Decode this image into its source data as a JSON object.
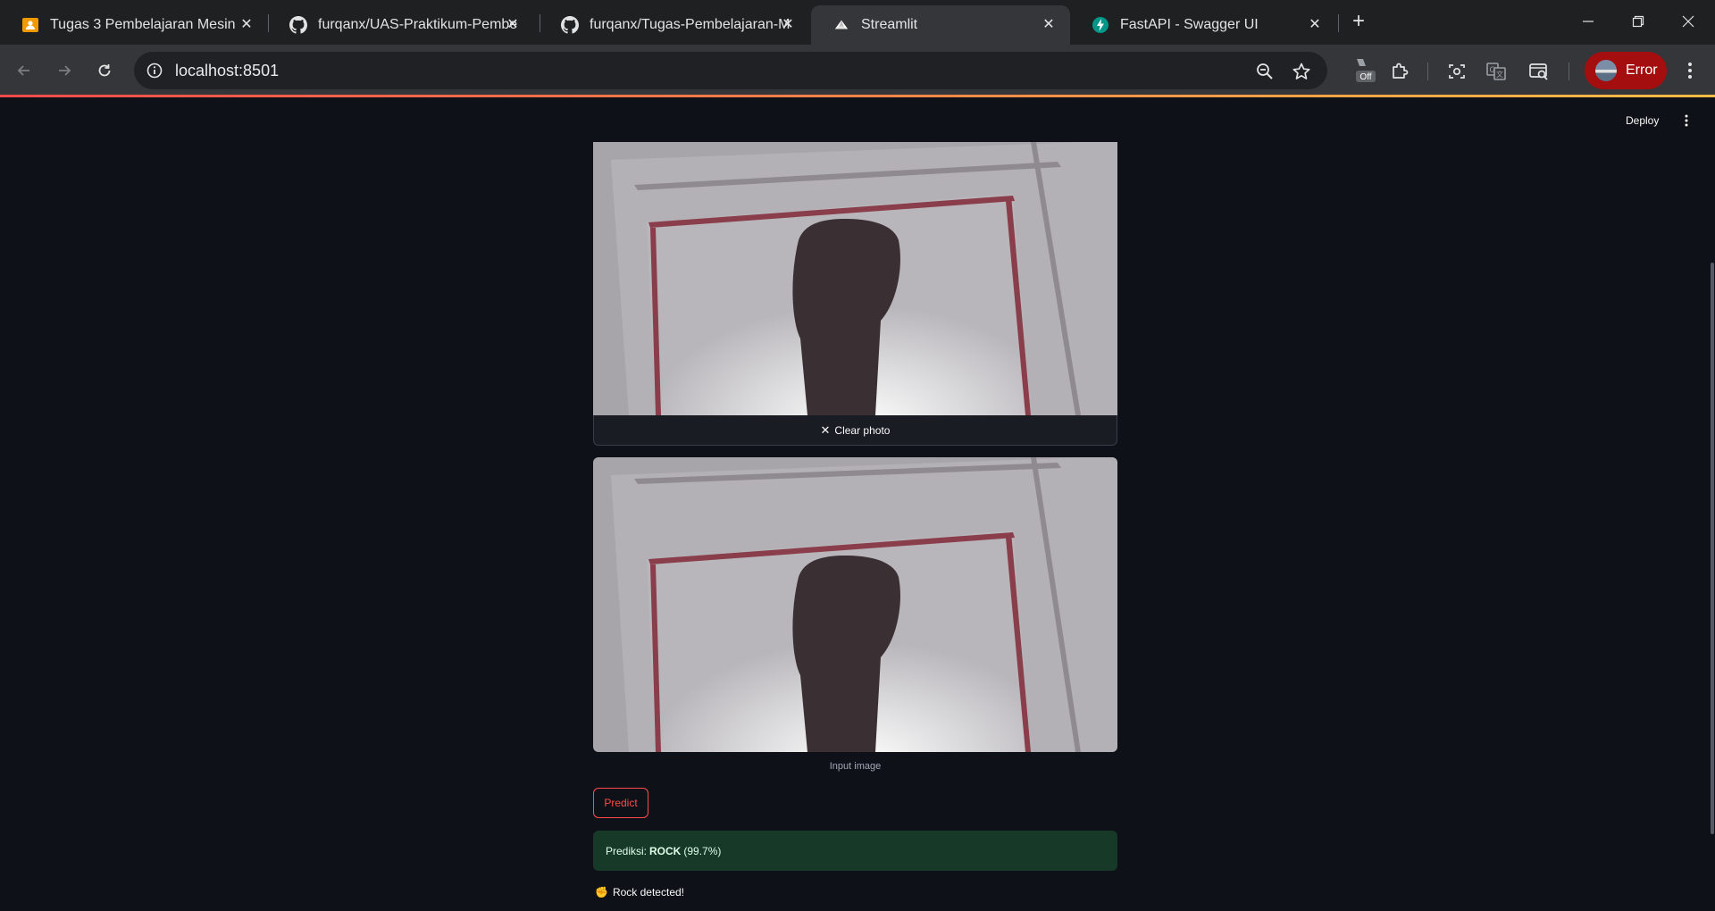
{
  "browser": {
    "tabs": [
      {
        "title": "Tugas 3 Pembelajaran Mesin",
        "icon": "classroom-icon",
        "active": false
      },
      {
        "title": "furqanx/UAS-Praktikum-Pembe",
        "icon": "github-icon",
        "active": false
      },
      {
        "title": "furqanx/Tugas-Pembelajaran-M",
        "icon": "github-icon",
        "active": false
      },
      {
        "title": "Streamlit",
        "icon": "streamlit-icon",
        "active": true
      },
      {
        "title": "FastAPI - Swagger UI",
        "icon": "fastapi-icon",
        "active": false
      }
    ],
    "url": "localhost:8501",
    "profile_label": "Error",
    "extension_badge": "Off"
  },
  "app": {
    "deploy_label": "Deploy",
    "clear_photo_label": "Clear photo",
    "caption": "Input image",
    "predict_label": "Predict",
    "result_prefix": "Prediksi:",
    "result_class": "ROCK",
    "result_confidence": "(99.7%)",
    "detected_text": "Rock detected!",
    "detected_emoji": "✊"
  },
  "colors": {
    "accent": "#ff4b4b",
    "success_bg": "#173928",
    "page_bg": "#0e1117",
    "profile_error": "#a50e0e"
  }
}
